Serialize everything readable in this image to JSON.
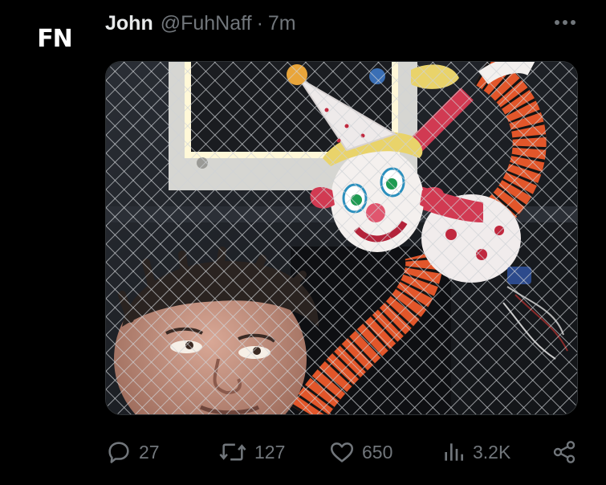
{
  "avatar": {
    "initials": "FN"
  },
  "tweet": {
    "display_name": "John",
    "handle": "@FuhNaff",
    "separator": "·",
    "time": "7m",
    "media": {
      "description_icon": "photo-media"
    },
    "actions": {
      "replies": "27",
      "reposts": "127",
      "likes": "650",
      "views": "3.2K"
    }
  },
  "icons": {
    "reply": "speech-bubble-icon",
    "repost": "repost-arrows-icon",
    "like": "heart-icon",
    "views": "bar-chart-icon",
    "share": "share-nodes-icon",
    "more": "ellipsis-icon"
  },
  "colors": {
    "background": "#000000",
    "primary_text": "#e7e9ea",
    "secondary_text": "#71767b"
  }
}
